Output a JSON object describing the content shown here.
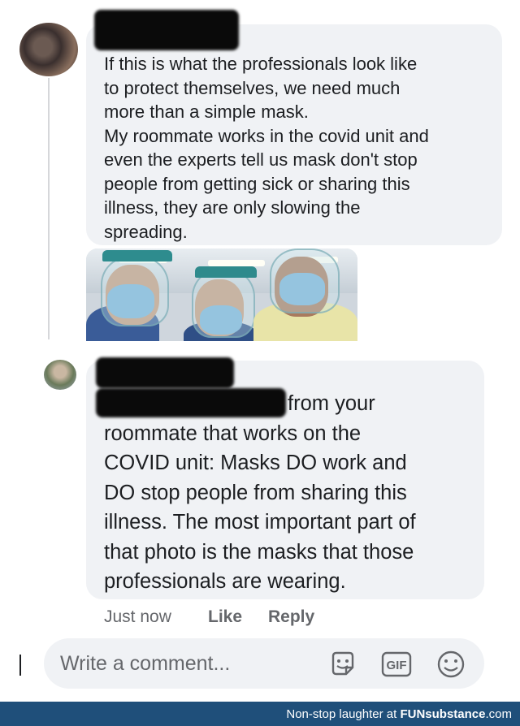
{
  "comments": [
    {
      "text": "If this is what the professionals look like\nto protect themselves, we need much\nmore than a simple mask.\nMy roommate works in the covid unit and\neven the experts tell us mask don't stop\npeople from getting sick or sharing this\nillness, they are only slowing the\nspreading."
    },
    {
      "text": "from your\nroommate that works on the\nCOVID unit: Masks DO work and\nDO stop people from sharing this\nillness. The most important part of\nthat photo is the masks that those\nprofessionals are wearing.",
      "time": "Just now",
      "like_label": "Like",
      "reply_label": "Reply"
    }
  ],
  "composer": {
    "placeholder": "Write a comment..."
  },
  "footer": {
    "tagline": "Non-stop laughter at",
    "brand": "FUNsubstance",
    "domain": ".com"
  },
  "colors": {
    "bubble": "#f0f2f5",
    "muted_text": "#65676b",
    "footer_bg": "#1f4f7a"
  },
  "icons": [
    "profile-photo",
    "sticker-icon",
    "gif-icon",
    "emoji-icon"
  ]
}
